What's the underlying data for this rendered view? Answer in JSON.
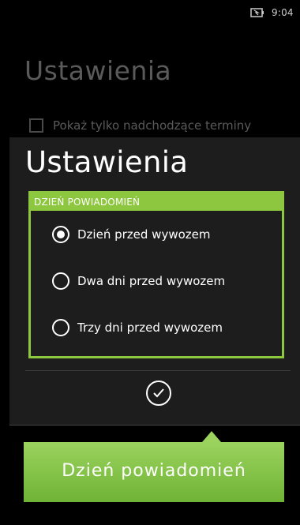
{
  "status_bar": {
    "time": "9:04",
    "battery_icon": "battery-icon"
  },
  "background": {
    "title": "Ustawienia",
    "checkbox_label": "Pokaż tylko nadchodzące terminy"
  },
  "dialog": {
    "title": "Ustawienia",
    "group_header": "DZIEŃ POWIADOMIEŃ",
    "options": [
      {
        "label": "Dzień przed wywozem",
        "checked": true
      },
      {
        "label": "Dwa dni przed wywozem",
        "checked": false
      },
      {
        "label": "Trzy dni przed wywozem",
        "checked": false
      }
    ],
    "confirm_icon": "checkmark-icon"
  },
  "tooltip": {
    "text": "Dzień powiadomień"
  },
  "colors": {
    "accent": "#8dc63f",
    "background": "#000000",
    "dialog": "#1d1d1d"
  }
}
